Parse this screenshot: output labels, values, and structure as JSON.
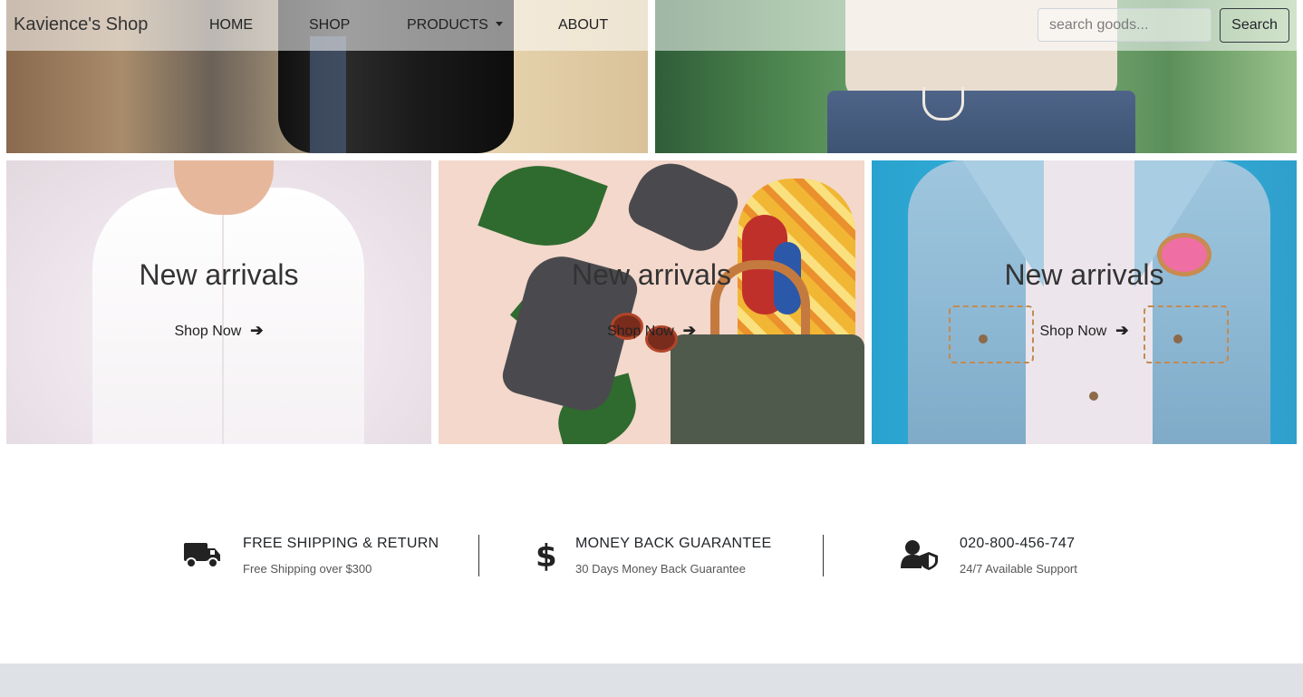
{
  "navbar": {
    "brand": "Kavience's Shop",
    "links": [
      {
        "label": "HOME"
      },
      {
        "label": "SHOP"
      },
      {
        "label": "PRODUCTS"
      },
      {
        "label": "ABOUT"
      }
    ],
    "search": {
      "placeholder": "search goods...",
      "value": "",
      "button_label": "Search"
    }
  },
  "banners": [
    {
      "title": "New arrivals",
      "link_label": "Shop Now"
    },
    {
      "title": "New arrivals",
      "link_label": "Shop Now"
    },
    {
      "title": "New arrivals",
      "link_label": "Shop Now"
    }
  ],
  "features": [
    {
      "icon": "truck-icon",
      "title": "FREE SHIPPING & RETURN",
      "subtitle": "Free Shipping over $300"
    },
    {
      "icon": "dollar-icon",
      "title": "MONEY BACK GUARANTEE",
      "subtitle": "30 Days Money Back Guarantee"
    },
    {
      "icon": "user-shield-icon",
      "title": "020-800-456-747",
      "subtitle": "24/7 Available Support"
    }
  ],
  "colors": {
    "footer_bg": "#dee2e6",
    "text": "#212529"
  }
}
